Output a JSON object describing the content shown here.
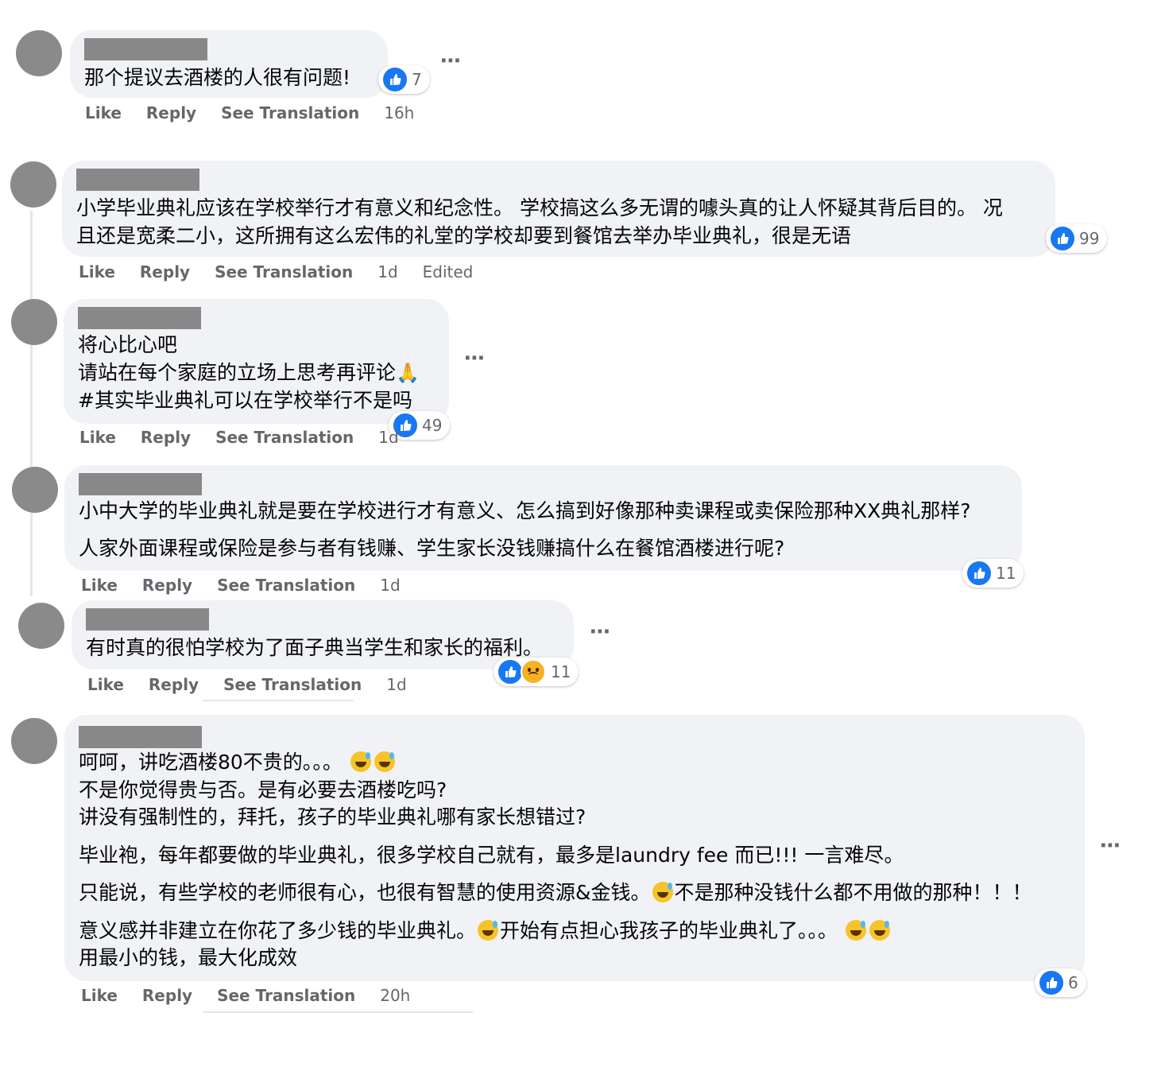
{
  "actions": {
    "like": "Like",
    "reply": "Reply",
    "see_translation": "See Translation",
    "edited": "Edited"
  },
  "more_icon": "⋯",
  "comments": [
    {
      "lines": [
        "那个提议去酒楼的人很有问题!"
      ],
      "time": "16h",
      "reactions": "7",
      "reaction_types": [
        "like"
      ]
    },
    {
      "lines": [
        "小学毕业典礼应该在学校举行才有意义和纪念性。 学校搞这么多无谓的噱头真的让人怀疑其背后目的。 况",
        "且还是宽柔二小，这所拥有这么宏伟的礼堂的学校却要到餐馆去举办毕业典礼，很是无语"
      ],
      "time": "1d",
      "reactions": "99",
      "reaction_types": [
        "like"
      ]
    },
    {
      "lines": [
        "将心比心吧",
        "请站在每个家庭的立场上思考再评论",
        "#其实毕业典礼可以在学校举行不是吗"
      ],
      "time": "1d",
      "reactions": "49",
      "reaction_types": [
        "like"
      ],
      "emoji_after_line1": "🙏"
    },
    {
      "lines": [
        "小中大学的毕业典礼就是要在学校进行才有意义、怎么搞到好像那种卖课程或卖保险那种XX典礼那样?",
        "人家外面课程或保险是参与者有钱赚、学生家长没钱赚搞什么在餐馆酒楼进行呢?"
      ],
      "time": "1d",
      "reactions": "11",
      "reaction_types": [
        "like"
      ]
    },
    {
      "lines": [
        "有时真的很怕学校为了面子典当学生和家长的福利。"
      ],
      "time": "1d",
      "reactions": "11",
      "reaction_types": [
        "like",
        "sad"
      ]
    },
    {
      "lines": [
        "呵呵，讲吃酒楼80不贵的。。。",
        "不是你觉得贵与否。是有必要去酒楼吃吗?",
        "讲没有强制性的，拜托，孩子的毕业典礼哪有家长想错过?",
        "毕业袍，每年都要做的毕业典礼，很多学校自己就有，最多是laundry fee 而已!!! 一言难尽。",
        "只能说，有些学校的老师很有心，也很有智慧的使用资源&金钱。",
        "不是那种没钱什么都不用做的那种！！！",
        "意义感并非建立在你花了多少钱的毕业典礼。",
        "开始有点担心我孩子的毕业典礼了。。。",
        "用最小的钱，最大化成效"
      ],
      "time": "20h",
      "reactions": "6",
      "reaction_types": [
        "like"
      ],
      "emoji_name": "grinning-sweat-face"
    }
  ]
}
